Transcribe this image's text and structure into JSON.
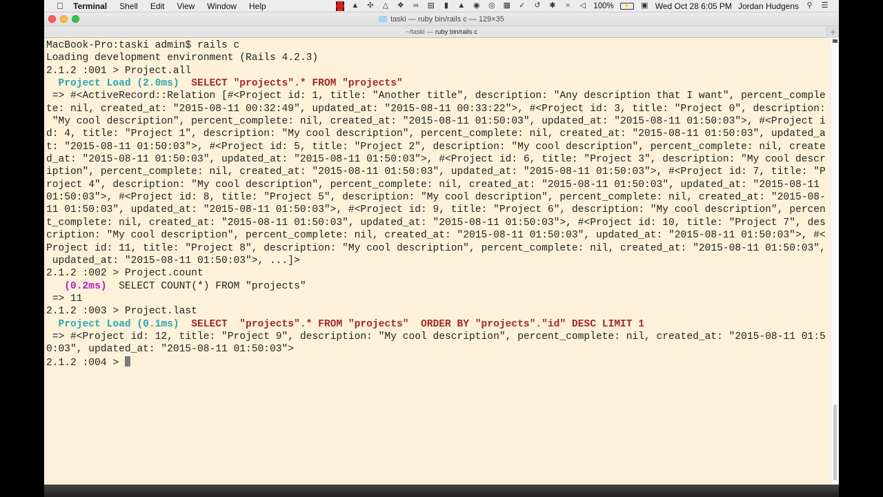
{
  "menubar": {
    "apple_icon": "apple-logo-icon",
    "app_name": "Terminal",
    "menus": [
      "Shell",
      "Edit",
      "View",
      "Window",
      "Help"
    ],
    "tray_icons": [
      "screen-recorder-icon",
      "evernote-elephant-icon",
      "fan-icon",
      "google-drive-icon",
      "dropbox-icon",
      "infinity-icon",
      "network-icon",
      "evernote-icon",
      "lock-icon",
      "creative-cloud-icon",
      "circle-icon",
      "grid-icon",
      "check-icon",
      "time-machine-icon",
      "bluetooth-icon",
      "wifi-icon",
      "volume-icon"
    ],
    "battery_percent": "100%",
    "calendar_icon": "calendar-icon",
    "clock": "Wed Oct 28  6:05 PM",
    "user": "Jordan Hudgens",
    "search_icon": "spotlight-icon",
    "notification_icon": "notification-center-icon"
  },
  "window": {
    "title": "taski — ruby bin/rails c — 129×35",
    "tab_path": "~/taski —",
    "tab_command": "ruby bin/rails c",
    "new_tab_label": "+"
  },
  "terminal": {
    "lines": [
      [
        {
          "t": "MacBook-Pro:taski admin$ rails c"
        }
      ],
      [
        {
          "t": "Loading development environment (Rails 4.2.3)"
        }
      ],
      [
        {
          "t": "2.1.2 :001 > Project.all"
        }
      ],
      [
        {
          "t": "  "
        },
        {
          "t": "Project Load (2.0ms)",
          "c": "cyan"
        },
        {
          "t": "  "
        },
        {
          "t": "SELECT \"projects\".* FROM \"projects\"",
          "c": "red"
        }
      ],
      [
        {
          "t": " => #<ActiveRecord::Relation [#<Project id: 1, title: \"Another title\", description: \"Any description that I want\", percent_comple"
        }
      ],
      [
        {
          "t": "te: nil, created_at: \"2015-08-11 00:32:49\", updated_at: \"2015-08-11 00:33:22\">, #<Project id: 3, title: \"Project 0\", description:"
        }
      ],
      [
        {
          "t": " \"My cool description\", percent_complete: nil, created_at: \"2015-08-11 01:50:03\", updated_at: \"2015-08-11 01:50:03\">, #<Project i"
        }
      ],
      [
        {
          "t": "d: 4, title: \"Project 1\", description: \"My cool description\", percent_complete: nil, created_at: \"2015-08-11 01:50:03\", updated_a"
        }
      ],
      [
        {
          "t": "t: \"2015-08-11 01:50:03\">, #<Project id: 5, title: \"Project 2\", description: \"My cool description\", percent_complete: nil, create"
        }
      ],
      [
        {
          "t": "d_at: \"2015-08-11 01:50:03\", updated_at: \"2015-08-11 01:50:03\">, #<Project id: 6, title: \"Project 3\", description: \"My cool descr"
        }
      ],
      [
        {
          "t": "iption\", percent_complete: nil, created_at: \"2015-08-11 01:50:03\", updated_at: \"2015-08-11 01:50:03\">, #<Project id: 7, title: \"P"
        }
      ],
      [
        {
          "t": "roject 4\", description: \"My cool description\", percent_complete: nil, created_at: \"2015-08-11 01:50:03\", updated_at: \"2015-08-11"
        }
      ],
      [
        {
          "t": "01:50:03\">, #<Project id: 8, title: \"Project 5\", description: \"My cool description\", percent_complete: nil, created_at: \"2015-08-"
        }
      ],
      [
        {
          "t": "11 01:50:03\", updated_at: \"2015-08-11 01:50:03\">, #<Project id: 9, title: \"Project 6\", description: \"My cool description\", percen"
        }
      ],
      [
        {
          "t": "t_complete: nil, created_at: \"2015-08-11 01:50:03\", updated_at: \"2015-08-11 01:50:03\">, #<Project id: 10, title: \"Project 7\", des"
        }
      ],
      [
        {
          "t": "cription: \"My cool description\", percent_complete: nil, created_at: \"2015-08-11 01:50:03\", updated_at: \"2015-08-11 01:50:03\">, #<"
        }
      ],
      [
        {
          "t": "Project id: 11, title: \"Project 8\", description: \"My cool description\", percent_complete: nil, created_at: \"2015-08-11 01:50:03\","
        }
      ],
      [
        {
          "t": " updated_at: \"2015-08-11 01:50:03\">, ...]>"
        }
      ],
      [
        {
          "t": "2.1.2 :002 > Project.count"
        }
      ],
      [
        {
          "t": "   "
        },
        {
          "t": "(0.2ms)",
          "c": "magenta"
        },
        {
          "t": "  SELECT COUNT(*) FROM \"projects\""
        }
      ],
      [
        {
          "t": " => 11"
        }
      ],
      [
        {
          "t": "2.1.2 :003 > Project.last"
        }
      ],
      [
        {
          "t": "  "
        },
        {
          "t": "Project Load (0.1ms)",
          "c": "cyan"
        },
        {
          "t": "  "
        },
        {
          "t": "SELECT  \"projects\".* FROM \"projects\"  ORDER BY \"projects\".\"id\" DESC LIMIT 1",
          "c": "red"
        }
      ],
      [
        {
          "t": " => #<Project id: 12, title: \"Project 9\", description: \"My cool description\", percent_complete: nil, created_at: \"2015-08-11 01:5"
        }
      ],
      [
        {
          "t": "0:03\", updated_at: \"2015-08-11 01:50:03\">"
        }
      ],
      [
        {
          "t": "2.1.2 :004 > "
        },
        {
          "cursor": true
        }
      ]
    ]
  }
}
